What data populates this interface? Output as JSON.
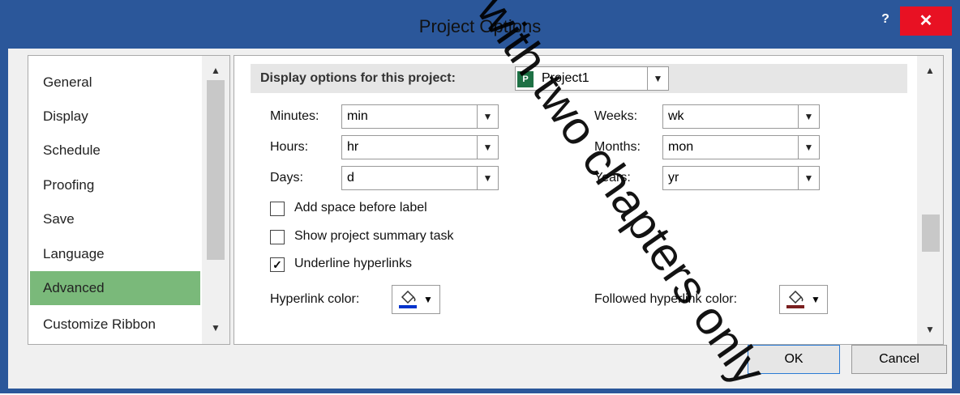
{
  "window": {
    "title": "Project Options",
    "help_label": "?",
    "close_label": "✕"
  },
  "nav": {
    "items": [
      {
        "label": "General"
      },
      {
        "label": "Display"
      },
      {
        "label": "Schedule"
      },
      {
        "label": "Proofing"
      },
      {
        "label": "Save"
      },
      {
        "label": "Language"
      },
      {
        "label": "Advanced",
        "selected": true
      },
      {
        "label": "Customize Ribbon"
      }
    ]
  },
  "section": {
    "label": "Display options for this project:",
    "project": "Project1",
    "project_icon": "project-file-icon"
  },
  "fields": {
    "minutes": {
      "label": "Minutes:",
      "value": "min"
    },
    "hours": {
      "label": "Hours:",
      "value": "hr"
    },
    "days": {
      "label": "Days:",
      "value": "d"
    },
    "weeks": {
      "label": "Weeks:",
      "value": "wk"
    },
    "months": {
      "label": "Months:",
      "value": "mon"
    },
    "years": {
      "label": "Years:",
      "value": "yr"
    }
  },
  "checkboxes": [
    {
      "label": "Add space before label",
      "checked": false
    },
    {
      "label": "Show project summary task",
      "checked": false
    },
    {
      "label": "Underline hyperlinks",
      "checked": true
    }
  ],
  "hyperlink": {
    "label": "Hyperlink color:",
    "color": "#0033cc"
  },
  "followed": {
    "label": "Followed hyperlink color:",
    "color": "#7a1f1f"
  },
  "buttons": {
    "ok": "OK",
    "cancel": "Cancel"
  },
  "watermark": "ok with two chapters only",
  "colors": {
    "accent": "#2b579a",
    "close": "#e81123",
    "selected": "#7ab97a"
  }
}
